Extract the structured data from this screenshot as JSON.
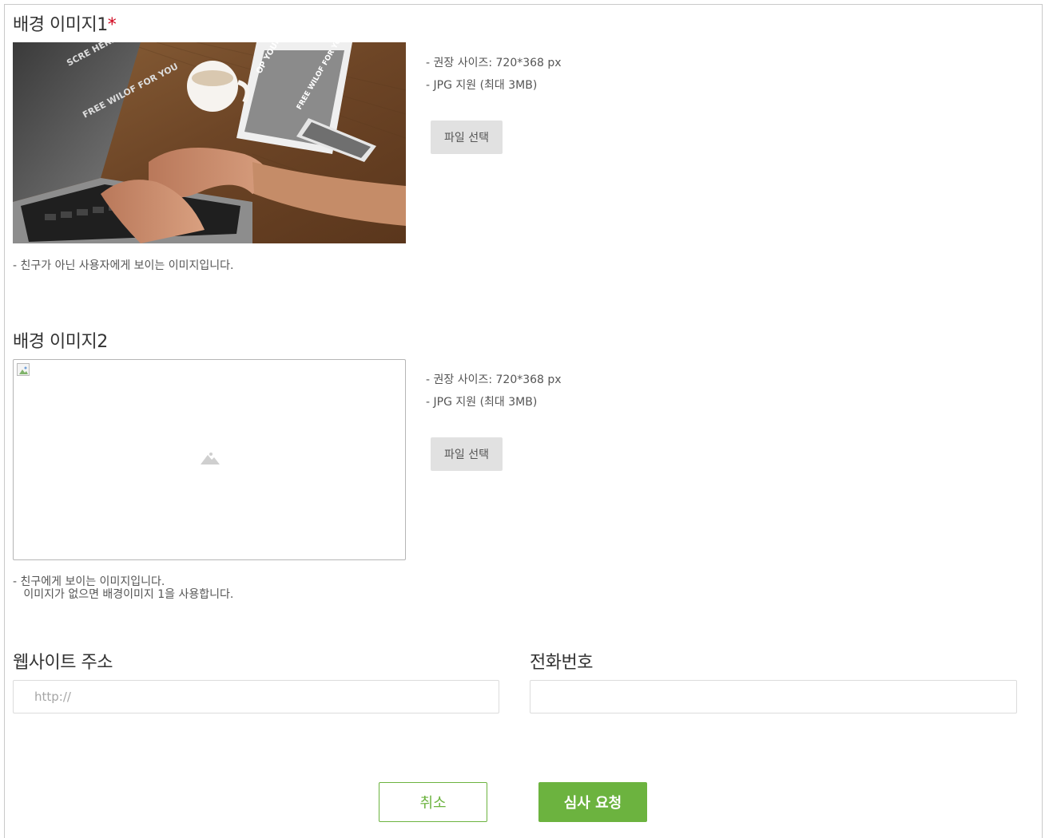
{
  "bg1": {
    "title": "배경 이미지1",
    "required_mark": "*",
    "hint_size": "- 권장 사이즈: 720*368 px",
    "hint_format": "- JPG 지원 (최대 3MB)",
    "file_button": "파일 선택",
    "note": "- 친구가 아닌 사용자에게 보이는 이미지입니다.",
    "image_text": {
      "screen_top": "SCRE HERE",
      "screen_brand": "FREE WILOF FOR YOU",
      "tablet_top": "OP YOUR SCREEN HERE",
      "tablet_brand": "FREE WILOF FOR YOU"
    }
  },
  "bg2": {
    "title": "배경 이미지2",
    "hint_size": "- 권장 사이즈: 720*368 px",
    "hint_format": "- JPG 지원 (최대 3MB)",
    "file_button": "파일 선택",
    "note": "- 친구에게 보이는 이미지입니다.\n   이미지가 없으면 배경이미지 1을 사용합니다."
  },
  "website": {
    "label": "웹사이트 주소",
    "value": "",
    "placeholder": "http://"
  },
  "phone": {
    "label": "전화번호",
    "value": "",
    "placeholder": ""
  },
  "actions": {
    "cancel": "취소",
    "submit": "심사 요청"
  },
  "colors": {
    "accent": "#6cb33f",
    "required": "#d0021b",
    "border": "#dcdcdc"
  }
}
